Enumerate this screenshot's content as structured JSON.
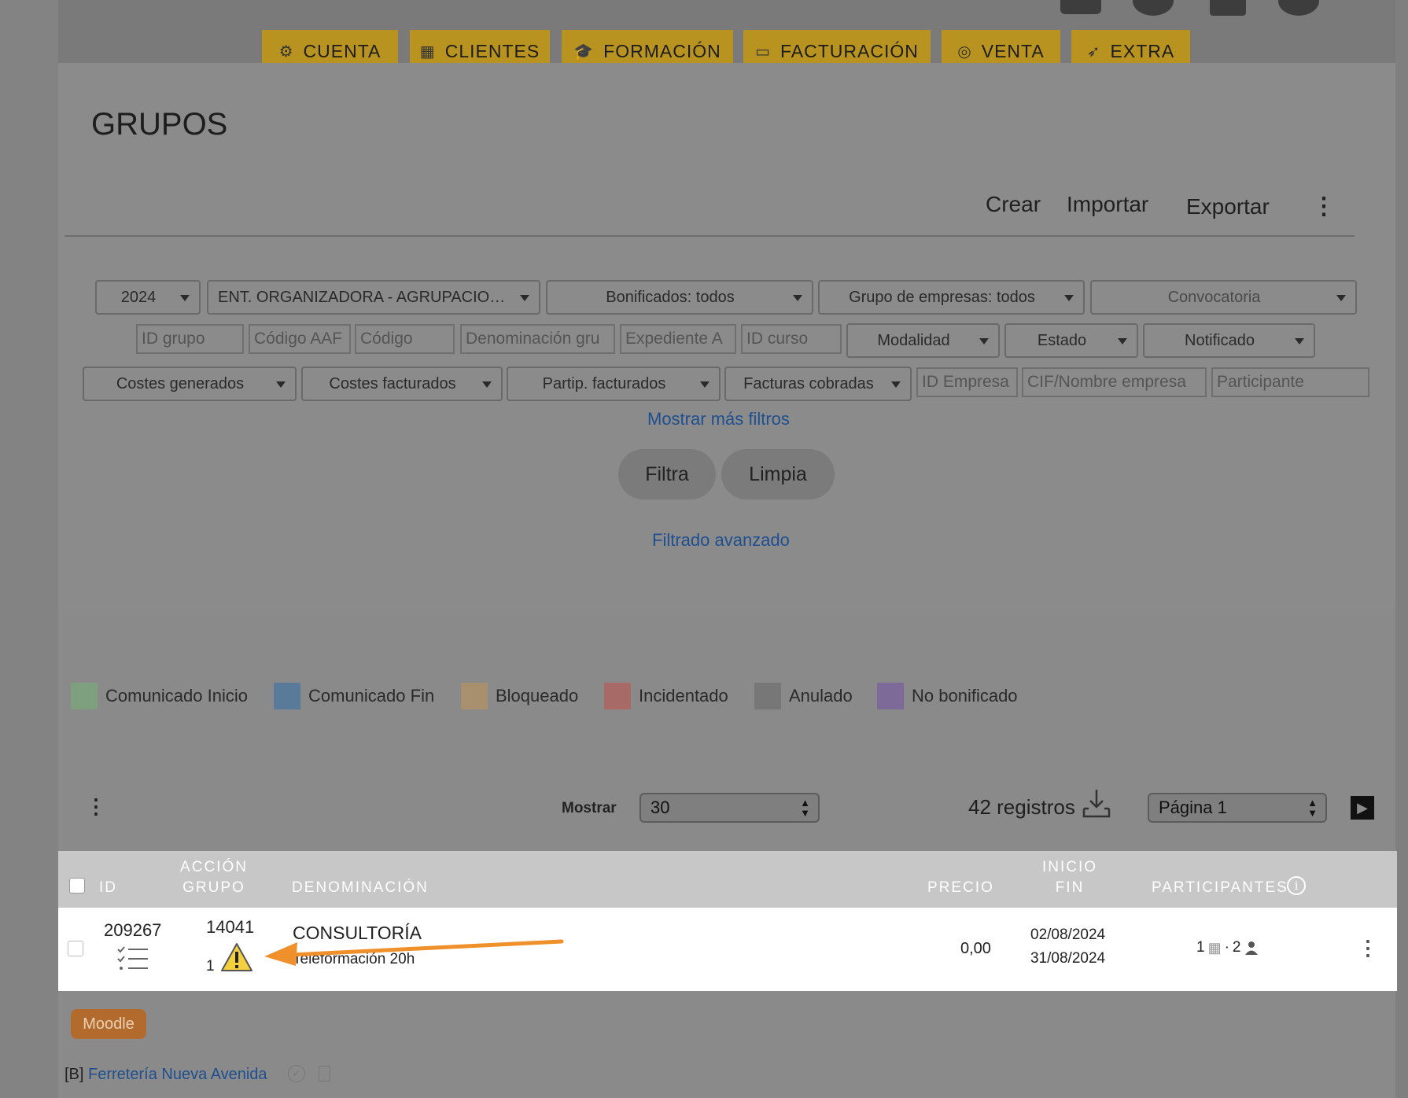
{
  "nav": [
    {
      "label": "CUENTA",
      "icon": "cogs-icon"
    },
    {
      "label": "CLIENTES",
      "icon": "building-icon"
    },
    {
      "label": "FORMACIÓN",
      "icon": "graduation-cap-icon"
    },
    {
      "label": "FACTURACIÓN",
      "icon": "money-bill-icon"
    },
    {
      "label": "VENTA",
      "icon": "bullseye-icon"
    },
    {
      "label": "EXTRA",
      "icon": "rocket-icon"
    }
  ],
  "page": {
    "title": "GRUPOS"
  },
  "toolbar": {
    "create": "Crear",
    "import": "Importar",
    "export": "Exportar"
  },
  "filters": {
    "year": "2024",
    "organizer": "ENT. ORGANIZADORA - AGRUPACIO…",
    "bonificados": "Bonificados: todos",
    "grupo_empresas": "Grupo de empresas: todos",
    "convocatoria": "Convocatoria",
    "id_grupo": "ID grupo",
    "codigo_aaf": "Código AAF",
    "codigo": "Código",
    "denominacion": "Denominación gru",
    "expediente": "Expediente A",
    "id_curso": "ID curso",
    "modalidad": "Modalidad",
    "estado": "Estado",
    "notificado": "Notificado",
    "costes_generados": "Costes generados",
    "costes_facturados": "Costes facturados",
    "partip_facturados": "Partip. facturados",
    "facturas_cobradas": "Facturas cobradas",
    "id_empresa": "ID Empresa",
    "cif_nombre": "CIF/Nombre empresa",
    "participante": "Participante",
    "more_filters": "Mostrar más filtros",
    "filter_btn": "Filtra",
    "clear_btn": "Limpia",
    "advanced": "Filtrado avanzado"
  },
  "legend": [
    {
      "label": "Comunicado Inicio",
      "color": "#7fa07f"
    },
    {
      "label": "Comunicado Fin",
      "color": "#5a7a9a"
    },
    {
      "label": "Bloqueado",
      "color": "#a8906f"
    },
    {
      "label": "Incidentado",
      "color": "#a86a66"
    },
    {
      "label": "Anulado",
      "color": "#777777"
    },
    {
      "label": "No bonificado",
      "color": "#7d6a98"
    }
  ],
  "listing": {
    "show_label": "Mostrar",
    "per_page": "30",
    "records": "42 registros",
    "page_select": "Página 1"
  },
  "table": {
    "headers": {
      "id": "ID",
      "accion": "ACCIÓN",
      "grupo": "GRUPO",
      "denominacion": "DENOMINACIÓN",
      "precio": "PRECIO",
      "inicio": "INICIO",
      "fin": "FIN",
      "participantes": "PARTICIPANTES"
    },
    "rows": [
      {
        "id": "209267",
        "accion": "14041",
        "grupo": "1",
        "title": "CONSULTORÍA",
        "subtitle": "Teleformación 20h",
        "precio": "0,00",
        "inicio": "02/08/2024",
        "fin": "31/08/2024",
        "empresas": "1",
        "participantes": "2"
      }
    ]
  },
  "footer": {
    "badge": "Moodle",
    "company_prefix": "[B]",
    "company": "Ferretería Nueva Avenida"
  }
}
